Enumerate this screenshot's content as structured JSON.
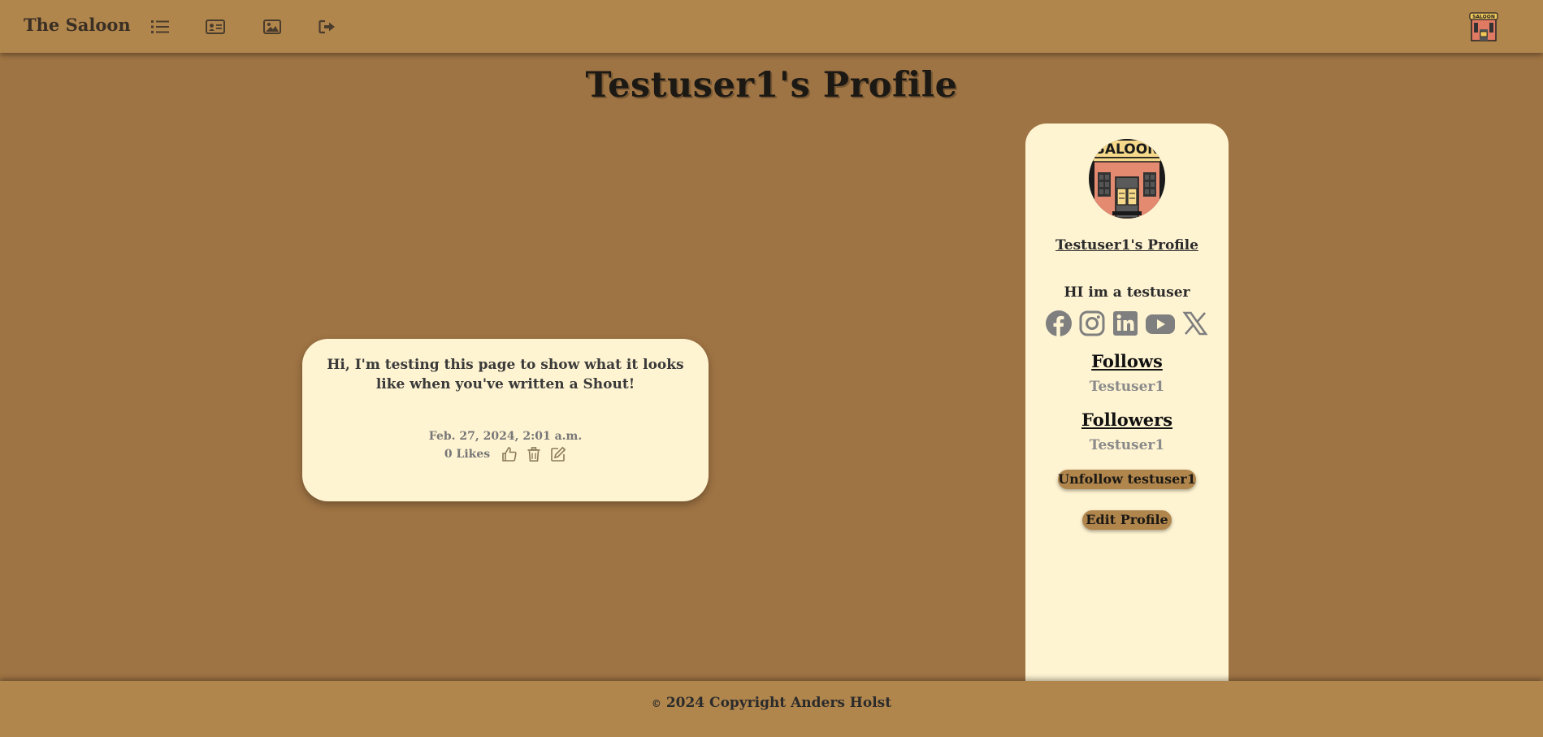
{
  "navbar": {
    "brand": "The Saloon",
    "icons": [
      "list-icon",
      "profile-card-icon",
      "image-icon",
      "logout-icon"
    ],
    "logo_sign_text": "SALOON"
  },
  "page": {
    "title": "Testuser1's Profile"
  },
  "shout": {
    "text": "Hi, I'm testing this page to show what it looks like when you've written a Shout!",
    "date": "Feb. 27, 2024, 2:01 a.m.",
    "likes": "0 Likes"
  },
  "profile": {
    "avatar_sign_text": "SALOON",
    "link": "Testuser1's Profile",
    "bio": "HI im a testuser",
    "socials": [
      "facebook-icon",
      "instagram-icon",
      "linkedin-icon",
      "youtube-icon",
      "x-icon"
    ],
    "follows_heading": "Follows",
    "follows_value": "Testuser1",
    "followers_heading": "Followers",
    "followers_value": "Testuser1",
    "unfollow_label": "Unfollow testuser1",
    "edit_label": "Edit Profile"
  },
  "footer": {
    "copyright_symbol": "©",
    "text": "2024 Copyright Anders Holst"
  },
  "colors": {
    "background": "#9f7444",
    "bar": "#b1864d",
    "card": "#fff4d2"
  }
}
